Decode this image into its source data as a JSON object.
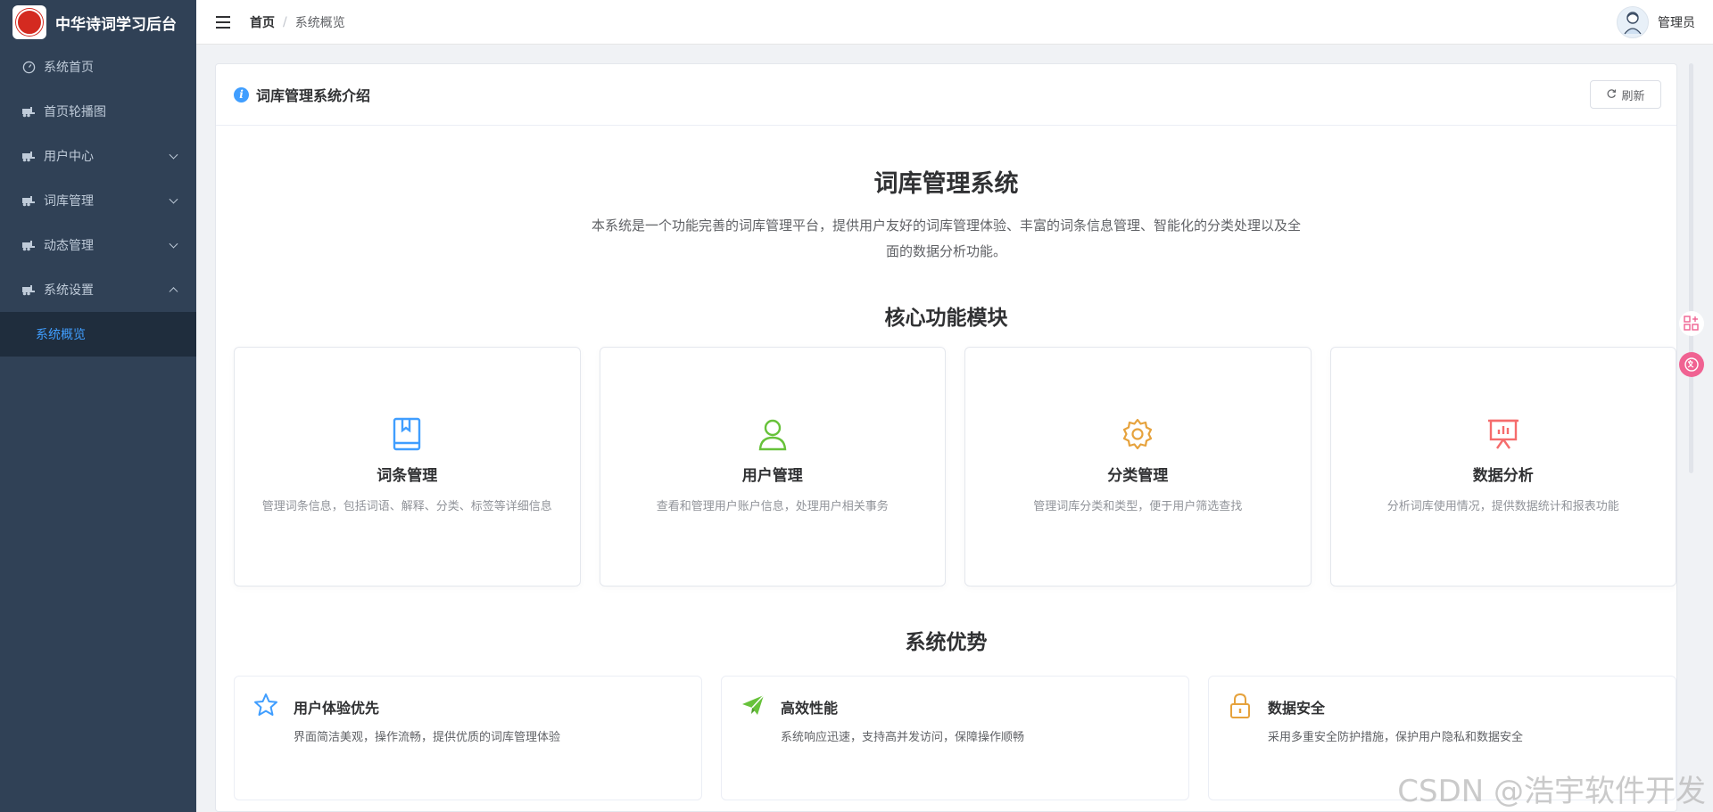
{
  "app": {
    "title": "中华诗词学习后台"
  },
  "sidebar": {
    "items": [
      {
        "label": "系统首页",
        "icon": "dashboard-icon"
      },
      {
        "label": "首页轮播图",
        "icon": "forklift-icon"
      },
      {
        "label": "用户中心",
        "icon": "forklift-icon"
      },
      {
        "label": "词库管理",
        "icon": "forklift-icon"
      },
      {
        "label": "动态管理",
        "icon": "forklift-icon"
      },
      {
        "label": "系统设置",
        "icon": "forklift-icon"
      }
    ],
    "sub_item": {
      "label": "系统概览"
    }
  },
  "header": {
    "breadcrumb": {
      "home": "首页",
      "separator": "/",
      "current": "系统概览"
    },
    "user": {
      "name": "管理员"
    }
  },
  "card": {
    "title": "词库管理系统介绍",
    "refresh_label": "刷新"
  },
  "intro": {
    "title": "词库管理系统",
    "description": "本系统是一个功能完善的词库管理平台，提供用户友好的词库管理体验、丰富的词条信息管理、智能化的分类处理以及全面的数据分析功能。"
  },
  "modules": {
    "title": "核心功能模块",
    "items": [
      {
        "title": "词条管理",
        "desc": "管理词条信息，包括词语、解释、分类、标签等详细信息",
        "icon": "book-icon",
        "color": "#409eff"
      },
      {
        "title": "用户管理",
        "desc": "查看和管理用户账户信息，处理用户相关事务",
        "icon": "user-icon",
        "color": "#67c23a"
      },
      {
        "title": "分类管理",
        "desc": "管理词库分类和类型，便于用户筛选查找",
        "icon": "gear-icon",
        "color": "#e6a23c"
      },
      {
        "title": "数据分析",
        "desc": "分析词库使用情况，提供数据统计和报表功能",
        "icon": "chart-board-icon",
        "color": "#f56c6c"
      }
    ]
  },
  "advantages": {
    "title": "系统优势",
    "items": [
      {
        "title": "用户体验优先",
        "desc": "界面简洁美观，操作流畅，提供优质的词库管理体验",
        "icon": "star-icon",
        "color": "#409eff"
      },
      {
        "title": "高效性能",
        "desc": "系统响应迅速，支持高并发访问，保障操作顺畅",
        "icon": "paper-plane-icon",
        "color": "#67c23a"
      },
      {
        "title": "数据安全",
        "desc": "采用多重安全防护措施，保护用户隐私和数据安全",
        "icon": "lock-icon",
        "color": "#e6a23c"
      }
    ]
  },
  "watermark": "CSDN @浩宇软件开发"
}
